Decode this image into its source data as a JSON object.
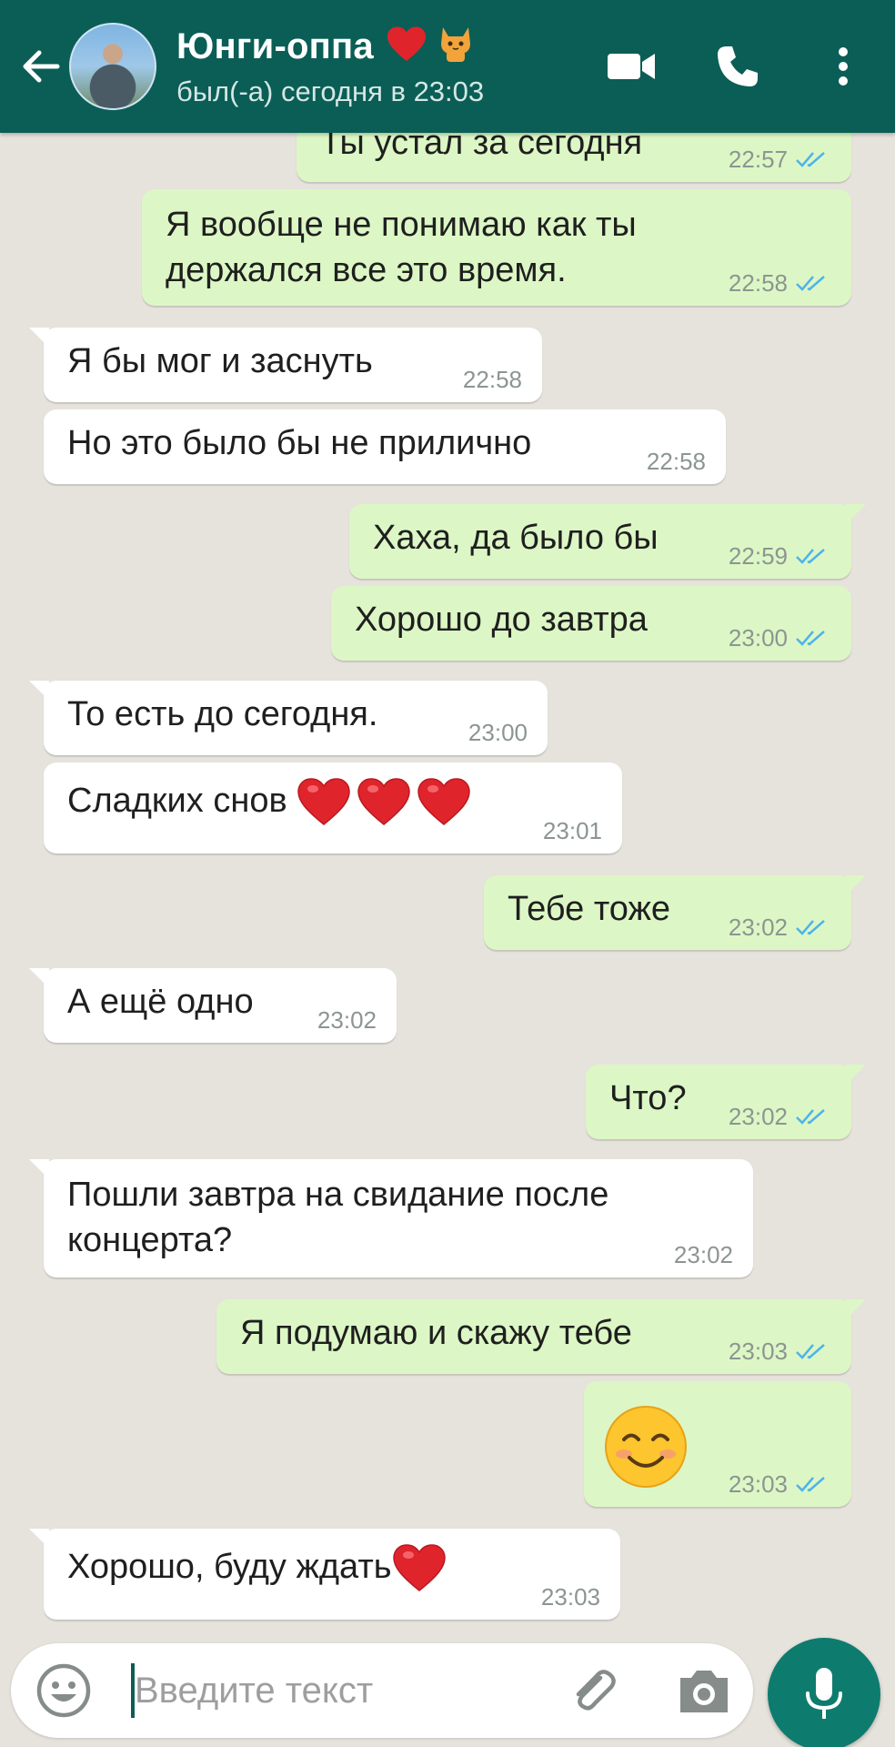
{
  "header": {
    "contact_name": "Юнги-оппа",
    "last_seen": "был(-а) сегодня в 23:03",
    "name_emojis": [
      "red-heart",
      "cat"
    ]
  },
  "messages": [
    {
      "dir": "out",
      "text": "Ты устал за сегодня",
      "time": "22:57",
      "read": true
    },
    {
      "dir": "out",
      "text": "Я вообще не понимаю как ты",
      "text2": "держался все это время.",
      "time": "22:58",
      "read": true
    },
    {
      "dir": "in",
      "text": "Я бы мог и заснуть",
      "time": "22:58"
    },
    {
      "dir": "in",
      "text": "Но это было бы не прилично",
      "time": "22:58"
    },
    {
      "dir": "out",
      "text": "Хаха, да было бы",
      "time": "22:59",
      "read": true
    },
    {
      "dir": "out",
      "text": "Хорошо до завтра",
      "time": "23:00",
      "read": true
    },
    {
      "dir": "in",
      "text": "То есть до сегодня.",
      "time": "23:00"
    },
    {
      "dir": "in",
      "text": "Сладких снов",
      "emojis": [
        "red-heart",
        "red-heart",
        "red-heart"
      ],
      "time": "23:01"
    },
    {
      "dir": "out",
      "text": "Тебе тоже",
      "time": "23:02",
      "read": true
    },
    {
      "dir": "in",
      "text": "А ещё одно",
      "time": "23:02"
    },
    {
      "dir": "out",
      "text": "Что?",
      "time": "23:02",
      "read": true
    },
    {
      "dir": "in",
      "text": "Пошли завтра на свидание после",
      "text2": "концерта?",
      "time": "23:02"
    },
    {
      "dir": "out",
      "text": "Я подумаю и скажу тебе",
      "time": "23:03",
      "read": true
    },
    {
      "dir": "out",
      "text": "",
      "emojis": [
        "smiling-face"
      ],
      "time": "23:03",
      "read": true
    },
    {
      "dir": "in",
      "text": "Хорошо, буду ждать",
      "emojis": [
        "red-heart"
      ],
      "time": "23:03"
    }
  ],
  "input": {
    "placeholder": "Введите текст"
  },
  "colors": {
    "header_bg": "#0a5e56",
    "chat_bg": "#e6e2dc",
    "outgoing_bubble": "#dcf7c5",
    "incoming_bubble": "#ffffff",
    "read_ticks": "#4fb3e8",
    "mic_button": "#0d7c6e"
  },
  "icons": [
    "back-arrow-icon",
    "video-call-icon",
    "phone-icon",
    "more-vert-icon",
    "emoji-icon",
    "attach-icon",
    "camera-icon",
    "mic-icon",
    "double-check-icon"
  ]
}
